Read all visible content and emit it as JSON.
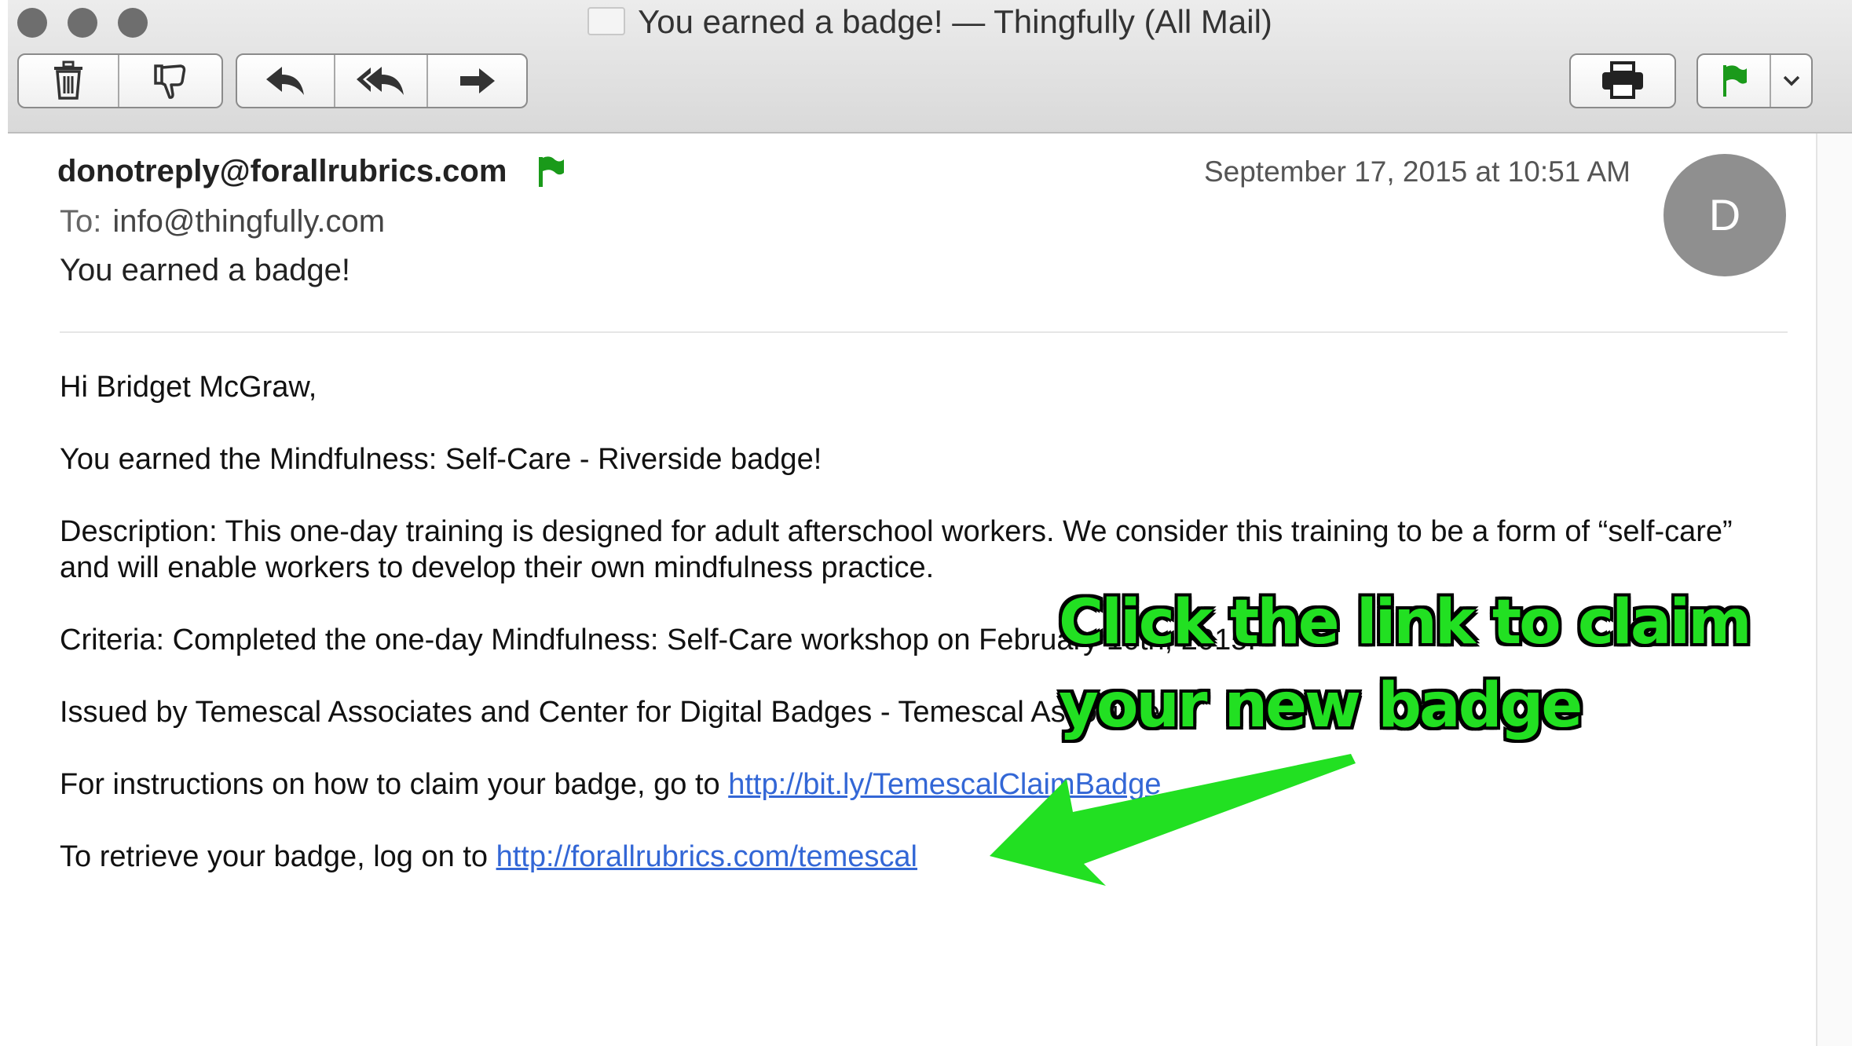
{
  "window": {
    "title": "You earned a badge! — Thingfully (All Mail)"
  },
  "toolbar": {
    "icons": [
      "trash-icon",
      "thumbs-down-icon",
      "reply-icon",
      "reply-all-icon",
      "forward-icon",
      "print-icon",
      "flag-icon",
      "chevron-down-icon"
    ],
    "flag_color": "#1a9a1a"
  },
  "message": {
    "from": "donotreply@forallrubrics.com",
    "date": "September 17, 2015 at 10:51 AM",
    "to_label": "To:",
    "to": "info@thingfully.com",
    "subject": "You earned a badge!",
    "avatar_initial": "D",
    "body": {
      "greeting": "Hi Bridget McGraw,",
      "earned": "You earned the Mindfulness: Self-Care - Riverside badge!",
      "description": "Description: This one-day training is designed for adult afterschool workers. We consider this training to be a form of “self-care” and will enable workers to develop their own mindfulness practice.",
      "criteria": "Criteria: Completed the one-day Mindfulness: Self-Care workshop on February 10th, 2015.",
      "issued": "Issued by Temescal Associates and Center for Digital Badges - Temescal Associates",
      "instructions_prefix": "For instructions on how to claim your badge, go to ",
      "instructions_link": "http://bit.ly/TemescalClaimBadge",
      "retrieve_prefix": "To retrieve your badge, log on to ",
      "retrieve_link": "http://forallrubrics.com/temescal"
    }
  },
  "annotation": {
    "line1": "Click the link to claim",
    "line2": "your new badge",
    "color": "#22e022"
  }
}
